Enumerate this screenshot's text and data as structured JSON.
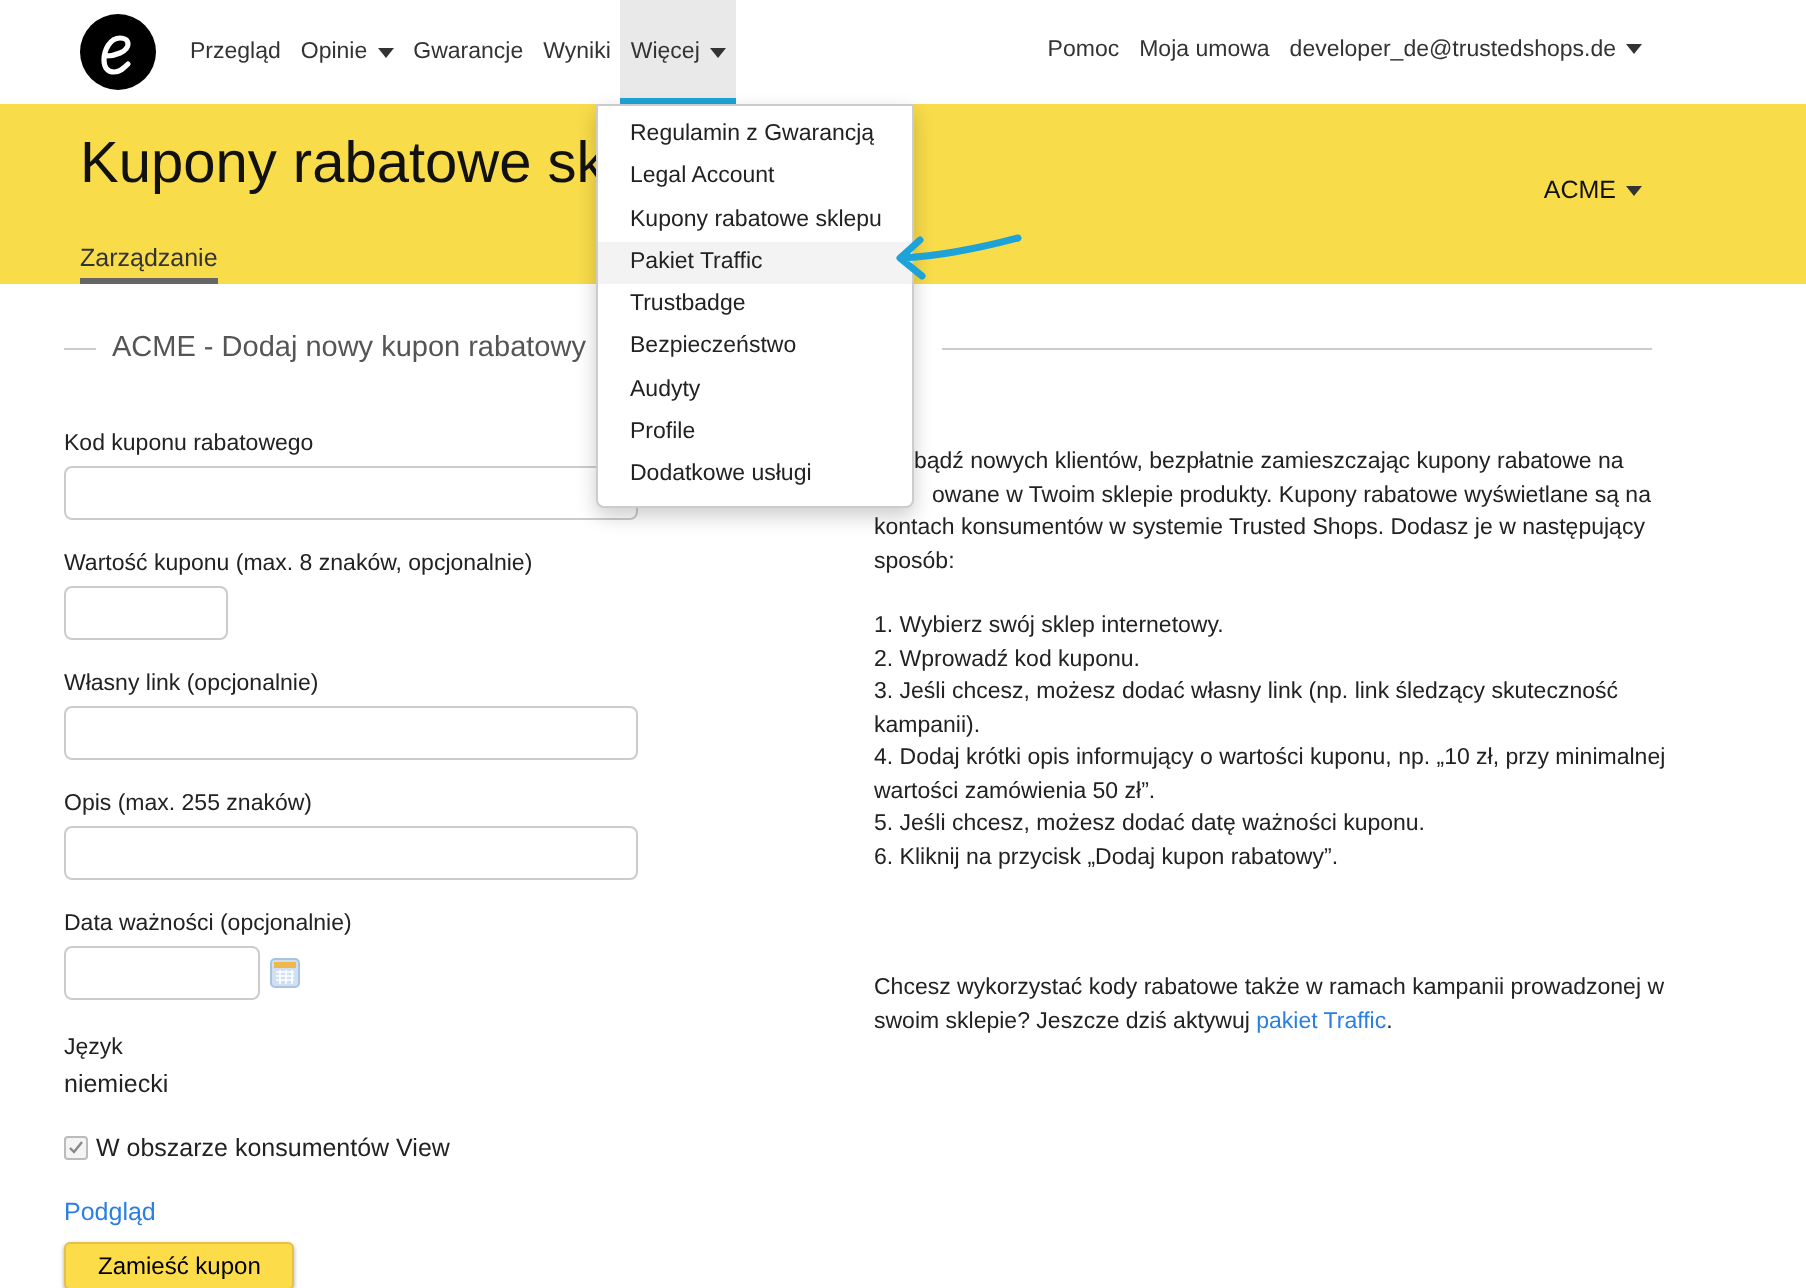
{
  "nav": {
    "items": [
      {
        "label": "Przegląd",
        "caret": false,
        "selected": false
      },
      {
        "label": "Opinie",
        "caret": true,
        "selected": false
      },
      {
        "label": "Gwarancje",
        "caret": false,
        "selected": false
      },
      {
        "label": "Wyniki",
        "caret": false,
        "selected": false
      },
      {
        "label": "Więcej",
        "caret": true,
        "selected": true
      }
    ],
    "right_items": [
      {
        "label": "Pomoc",
        "caret": false
      },
      {
        "label": "Moja umowa",
        "caret": false
      },
      {
        "label": "developer_de@trustedshops.de",
        "caret": true
      }
    ]
  },
  "header": {
    "title": "Kupony rabatowe sk",
    "shop_selector": "ACME",
    "tabs": [
      {
        "label": "Zarządzanie",
        "selected": true
      }
    ]
  },
  "dropdown": {
    "items": [
      {
        "label": "Regulamin z Gwarancją",
        "selected": false
      },
      {
        "label": "Legal Account",
        "selected": false
      },
      {
        "label": "Kupony rabatowe sklepu",
        "selected": false
      },
      {
        "label": "Pakiet Traffic",
        "selected": true
      },
      {
        "label": "Trustbadge",
        "selected": false
      },
      {
        "label": "Bezpieczeństwo",
        "selected": false
      },
      {
        "label": "Audyty",
        "selected": false
      },
      {
        "label": "Profile",
        "selected": false
      },
      {
        "label": "Dodatkowe usługi",
        "selected": false
      }
    ]
  },
  "section_title": "ACME - Dodaj nowy kupon rabatowy",
  "form": {
    "fields": [
      {
        "label": "Kod kuponu rabatowego",
        "kind": "wide"
      },
      {
        "label": "Wartość kuponu (max. 8 znaków, opcjonalnie)",
        "kind": "short"
      },
      {
        "label": "Własny link (opcjonalnie)",
        "kind": "wide"
      },
      {
        "label": "Opis (max. 255 znaków)",
        "kind": "wide"
      },
      {
        "label": "Data ważności (opcjonalnie)",
        "kind": "date"
      }
    ],
    "language": {
      "label": "Język",
      "value": "niemiecki"
    },
    "consumer_view": {
      "label": "W obszarze konsumentów View",
      "checked": true
    },
    "preview_link": "Podgląd",
    "submit": "Zamieść kupon"
  },
  "info": {
    "intro_lines": [
      "bądź nowych klientów, bezpłatnie zamieszczając kupony rabatowe na",
      "owane w Twoim sklepie produkty. Kupony rabatowe wyświetlane są na",
      "kontach konsumentów w systemie Trusted Shops. Dodasz je w następujący",
      "sposób:"
    ],
    "steps": [
      "1. Wybierz swój sklep internetowy.",
      "2. Wprowadź kod kuponu.",
      "3. Jeśli chcesz, możesz dodać własny link (np. link śledzący skuteczność kampanii).",
      "4. Dodaj krótki opis informujący o wartości kuponu, np. „10 zł, przy minimalnej wartości zamówienia 50 zł”.",
      "5. Jeśli chcesz, możesz dodać datę ważności kuponu.",
      "6. Kliknij na przycisk „Dodaj kupon rabatowy”."
    ],
    "outro": "Chcesz wykorzystać kody rabatowe także w ramach kampanii prowadzonej w swoim sklepie? Jeszcze dziś aktywuj",
    "outro_link": "pakiet Traffic",
    "outro_end": "."
  }
}
